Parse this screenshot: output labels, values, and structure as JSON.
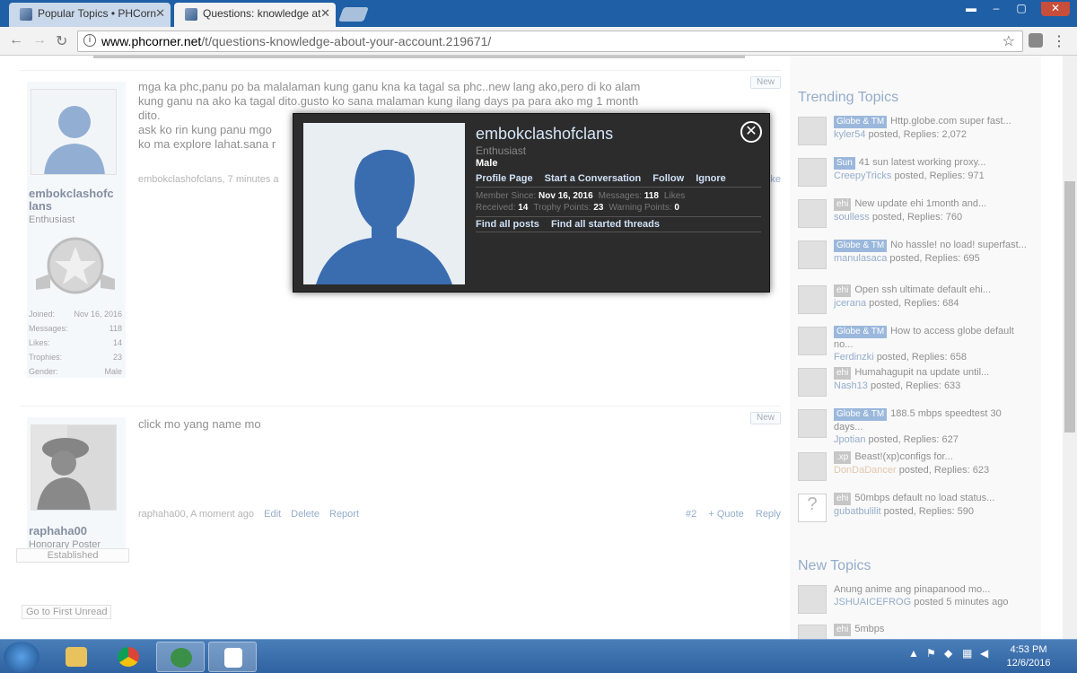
{
  "browser": {
    "tabs": [
      {
        "label": "Popular Topics • PHCorn"
      },
      {
        "label": "Questions: knowledge at"
      }
    ],
    "url_host": "www.phcorner.net",
    "url_path": "/t/questions-knowledge-about-your-account.219671/"
  },
  "posts": [
    {
      "username": "embokclashofclans",
      "username_line1": "embokclashofc",
      "username_line2": "lans",
      "user_title": "Enthusiast",
      "stats": [
        {
          "label": "Joined:",
          "value": "Nov 16, 2016"
        },
        {
          "label": "Messages:",
          "value": "118"
        },
        {
          "label": "Likes:",
          "value": "14"
        },
        {
          "label": "Trophies:",
          "value": "23"
        },
        {
          "label": "Gender:",
          "value": "Male"
        }
      ],
      "badge": "New",
      "message_lines": [
        "mga ka phc,panu po ba malalaman kung ganu kna ka tagal sa phc..new lang ako,pero di ko alam",
        "kung ganu na ako ka tagal dito.gusto ko sana malaman kung ilang days pa para ako mg 1 month",
        "dito.",
        "ask ko rin kung panu mgo",
        "ko ma explore lahat.sana r"
      ],
      "meta": "embokclashofclans, 7 minutes a",
      "meta_right": "ke"
    },
    {
      "username": "raphaha00",
      "user_title": "Honorary Poster",
      "rank": "Established",
      "badge": "New",
      "message_lines": [
        "click mo yang name mo"
      ],
      "meta": "raphaha00, A moment ago",
      "actions": [
        "Edit",
        "Delete",
        "Report"
      ],
      "right_actions": [
        "#2",
        "+ Quote",
        "Reply"
      ]
    }
  ],
  "go_first_unread": "Go to First Unread",
  "sidebar": {
    "trending_title": "Trending Topics",
    "trending": [
      {
        "tag": "Globe & TM",
        "title": "Http.globe.com super",
        "title2": "fast...",
        "author": "kyler54",
        "replies": "2,072"
      },
      {
        "tag": "Sun",
        "title": "41 sun latest working proxy...",
        "author": "CreepyTricks",
        "replies": "971"
      },
      {
        "tag": "ehi",
        "title": "New update ehi 1month and...",
        "author": "soulless",
        "replies": "760"
      },
      {
        "tag": "Globe & TM",
        "title": "No hassle! no load!",
        "title2": "superfast...",
        "author": "manulasaca",
        "replies": "695"
      },
      {
        "tag": "ehi",
        "title": "Open ssh ultimate default ehi...",
        "author": "jcerana",
        "replies": "684"
      },
      {
        "tag": "Globe & TM",
        "title": "How to access globe",
        "title2": "default no...",
        "author": "Ferdinzki",
        "replies": "658"
      },
      {
        "tag": "ehi",
        "title": "Humahagupit na update until...",
        "author": "Nash13",
        "replies": "633"
      },
      {
        "tag": "Globe & TM",
        "title": "188.5 mbps speedtest 30",
        "title2": "days...",
        "author": "Jpotian",
        "replies": "627"
      },
      {
        "tag": ".xp",
        "title": "Beast!(xp)configs for...",
        "author": "DonDaDancer",
        "replies": "623"
      },
      {
        "tag": "ehi",
        "title": "50mbps default no load status...",
        "author": "gubatbulilit",
        "replies": "590"
      }
    ],
    "posted_word": "posted, Replies:",
    "new_title": "New Topics",
    "new_topics": [
      {
        "title": "Anung anime ang pinapanood mo...",
        "author": "JSHUAICEFROG",
        "meta": "posted 5 minutes ago"
      },
      {
        "tag": "ehi",
        "title": "5mbps"
      }
    ]
  },
  "popup": {
    "name": "embokclashofclans",
    "title": "Enthusiast",
    "gender": "Male",
    "links": [
      "Profile Page",
      "Start a Conversation",
      "Follow",
      "Ignore"
    ],
    "member_since_label": "Member Since:",
    "member_since": "Nov 16, 2016",
    "messages_label": "Messages:",
    "messages": "118",
    "likes_label": "Likes",
    "received_label": "Received:",
    "received": "14",
    "trophy_label": "Trophy Points:",
    "trophy": "23",
    "warning_label": "Warning Points:",
    "warning": "0",
    "find": [
      "Find all posts",
      "Find all started threads"
    ]
  },
  "taskbar": {
    "time": "4:53 PM",
    "date": "12/6/2016"
  }
}
